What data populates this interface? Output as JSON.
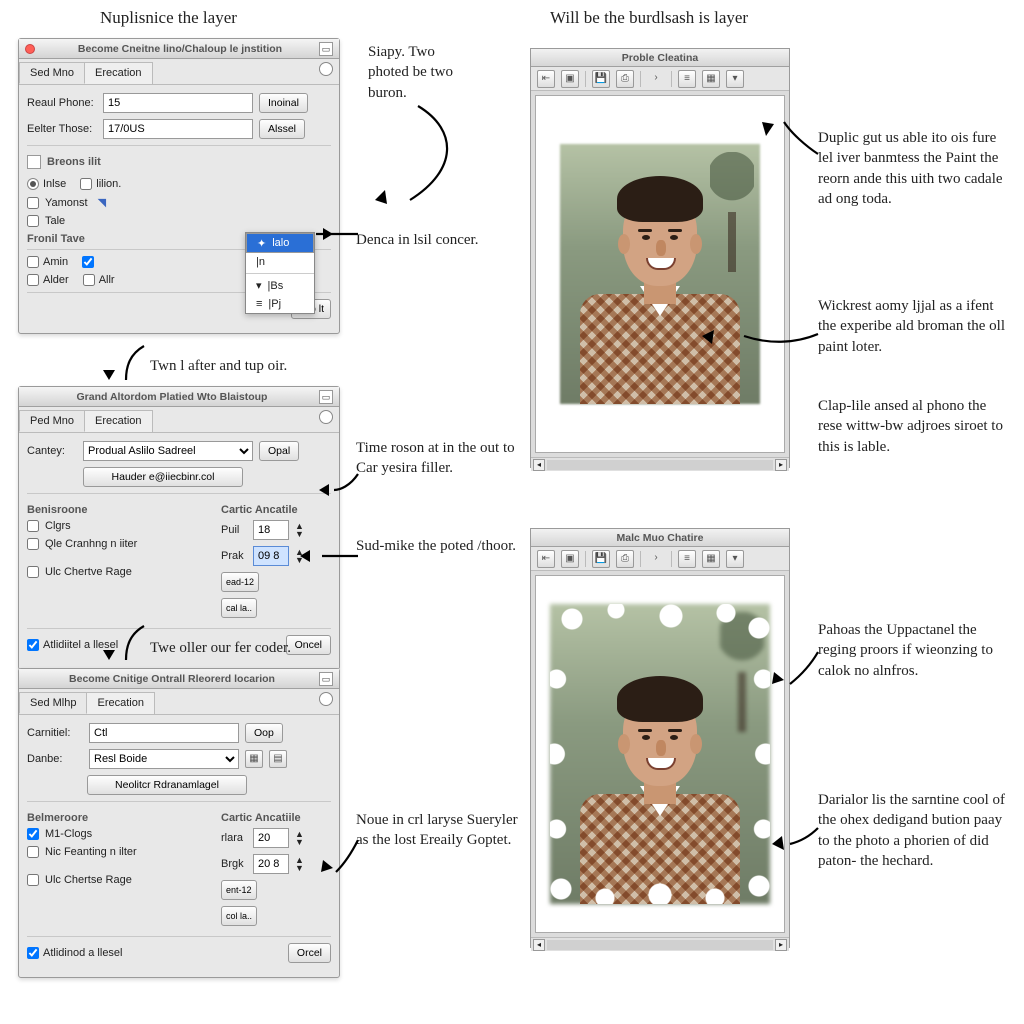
{
  "headings": {
    "top_left": "Nuplisnice the layer",
    "top_right": "Will be the burdlsash is layer"
  },
  "annotations": {
    "a1": "Siapy. Two photed be two buron.",
    "a2": "Denca in lsil concer.",
    "a3": "Twn l after and tup oir.",
    "a4": "Time roson at in the out to Car yesira filler.",
    "a5": "Sud-mike the poted /thoor.",
    "a6": "Twe oller our fer coder.",
    "a7": "Noue in crl laryse Sueryler as the lost Ereaily Goptet.",
    "r1": "Duplic gut us able ito ois fure lel iver banmtess the Paint the reorn ande this uith two cadale ad ong toda.",
    "r2": "Wickrest aomy ljjal as a ifent the experibe ald broman the oll paint loter.",
    "r3": "Clap-lile ansed al phono the rese wittw-bw adjroes siroet to this is lable.",
    "r4": "Pahoas the Uppactanel the reging proors if wieonzing to calok no alnfros.",
    "r5": "Darialor lis the sarntine cool of the ohex dedigand bution paay to the photo a phorien of did paton- the hechard."
  },
  "panel1": {
    "title": "Become Cneitne lino/Chaloup le jnstition",
    "tabs": {
      "a": "Sed Mno",
      "b": "Erecation"
    },
    "f1_label": "Reaul Phone:",
    "f1_value": "15",
    "f1_btn": "Inoinal",
    "f2_label": "Eelter Those:",
    "f2_value": "17/0US",
    "f2_btn": "Alssel",
    "group1": "Breons ilit",
    "c_inlse": "Inlse",
    "c_lilion": "lilion.",
    "c_yamonst": "Yamonst",
    "c_tale": "Tale",
    "group2": "Fronil Tave",
    "c_amin": "Amin",
    "c_alder": "Alder",
    "c_allr": "Allr",
    "btn_small": "oop lt",
    "dd": {
      "opt1": "lalo",
      "opt2": "|n",
      "opt3": "|Bs",
      "opt4": "|Pj"
    }
  },
  "panel2": {
    "title": "Grand Altordom Platied Wto Blaistoup",
    "tabs": {
      "a": "Ped Mno",
      "b": "Erecation"
    },
    "f1_label": "Cantey:",
    "f1_value": "Produal Aslilo Sadreel",
    "f1_btn": "Opal",
    "btn_row": "Hauder e@iiecbinr.col",
    "group1": "Benisroone",
    "c1": "Clgrs",
    "c2": "Qle Cranhng n iiter",
    "c3": "Ulc Chertve Rage",
    "group2": "Cartic Ancatile",
    "sp1_label": "Puil",
    "sp1_val": "18",
    "sp2_label": "Prak",
    "sp2_val": "09 8",
    "mini1": "ead-12",
    "mini2": "cal la..",
    "footer_chk": "Atlidiitel a llesel",
    "footer_btn": "Oncel"
  },
  "panel3": {
    "title": "Become Cnitige Ontrall Rleorerd locarion",
    "tabs": {
      "a": "Sed Mlhp",
      "b": "Erecation"
    },
    "f1_label": "Carnitiel:",
    "f1_value": "Ctl",
    "f1_btn": "Oop",
    "f2_label": "Danbe:",
    "f2_value": "Resl Boide",
    "btn_row": "Neolitcr Rdranamlagel",
    "group1": "Belmeroore",
    "c1": "M1-Clogs",
    "c2": "Nic Feanting n ilter",
    "c3": "Ulc Chertse Rage",
    "group2": "Cartic Ancatiile",
    "sp1_label": "rlara",
    "sp1_val": "20",
    "sp2_label": "Brgk",
    "sp2_val": "20 8",
    "mini1": "ent-12",
    "mini2": "col la..",
    "footer_chk": "Atlidinod a llesel",
    "footer_btn": "Orcel"
  },
  "imgwin1": {
    "title": "Proble Cleatina"
  },
  "imgwin2": {
    "title": "Malc Muo Chatire"
  }
}
